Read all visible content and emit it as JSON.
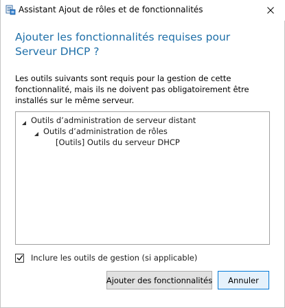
{
  "window": {
    "title": "Assistant Ajout de rôles et de fonctionnalités",
    "icon": "server-manager-icon",
    "close_icon": "close-icon"
  },
  "heading": "Ajouter les fonctionnalités requises pour Serveur DHCP ?",
  "description": "Les outils suivants sont requis pour la gestion de cette fonctionnalité, mais ils ne doivent pas obligatoirement être installés sur le même serveur.",
  "tree": {
    "items": [
      {
        "label": "Outils d’administration de serveur distant",
        "expanded": true
      },
      {
        "label": "Outils d’administration de rôles",
        "expanded": true
      },
      {
        "label": "[Outils] Outils du serveur DHCP"
      }
    ]
  },
  "checkbox": {
    "label": "Inclure les outils de gestion (si applicable)",
    "checked": true
  },
  "buttons": {
    "add_label": "Ajouter des fonctionnalités",
    "cancel_label": "Annuler"
  },
  "colors": {
    "heading": "#1e6fa8",
    "accent_border": "#0078d7",
    "accent_fill": "#e5f1fb"
  }
}
